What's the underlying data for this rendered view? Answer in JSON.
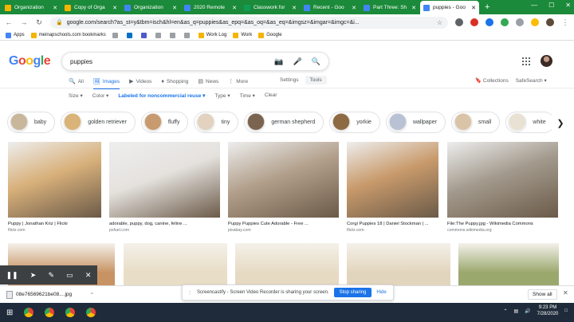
{
  "browser": {
    "tabs": [
      {
        "label": "Organization",
        "color": "#f4b400"
      },
      {
        "label": "Copy of Orga",
        "color": "#f4b400"
      },
      {
        "label": "Organization",
        "color": "#4285f4"
      },
      {
        "label": "2020 Remote",
        "color": "#4285f4"
      },
      {
        "label": "Classwork for",
        "color": "#0f9d58"
      },
      {
        "label": "Recent - Goo",
        "color": "#4285f4"
      },
      {
        "label": "Part Three: Sh",
        "color": "#4285f4"
      },
      {
        "label": "puppies - Goo",
        "color": "#4285f4",
        "active": true
      }
    ],
    "url": "google.com/search?as_st=y&tbm=isch&hl=en&as_q=puppies&as_epq=&as_oq=&as_eq=&imgsz=&imgar=&imgc=&i...",
    "bookmarks": [
      {
        "label": "Apps",
        "icon": "apps-icon"
      },
      {
        "label": "meinapschools.com bookmarks",
        "icon": "folder-icon"
      },
      {
        "label": "",
        "icon": "square-icon"
      },
      {
        "label": "",
        "icon": "outlook-icon"
      },
      {
        "label": "",
        "icon": "teams-icon"
      },
      {
        "label": "",
        "icon": "square-icon"
      },
      {
        "label": "",
        "icon": "square-icon"
      },
      {
        "label": "",
        "icon": "square-icon"
      },
      {
        "label": "Work Log",
        "icon": "folder-icon"
      },
      {
        "label": "Work",
        "icon": "folder-icon"
      },
      {
        "label": "Google",
        "icon": "folder-icon"
      }
    ]
  },
  "google": {
    "logo": "Google",
    "query": "puppies",
    "tabs": [
      {
        "label": "All",
        "icon": "search-icon"
      },
      {
        "label": "Images",
        "icon": "image-icon",
        "active": true
      },
      {
        "label": "Videos",
        "icon": "video-icon"
      },
      {
        "label": "Shopping",
        "icon": "tag-icon"
      },
      {
        "label": "News",
        "icon": "news-icon"
      },
      {
        "label": "More",
        "icon": "more-icon"
      }
    ],
    "settings": "Settings",
    "tools": "Tools",
    "collections": "Collections",
    "safesearch": "SafeSearch ▾",
    "filters": [
      {
        "label": "Size ▾"
      },
      {
        "label": "Color ▾"
      },
      {
        "label": "Labeled for noncommercial reuse ▾",
        "selected": true
      },
      {
        "label": "Type ▾"
      },
      {
        "label": "Time ▾"
      },
      {
        "label": "Clear"
      }
    ],
    "chips": [
      {
        "label": "baby",
        "color": "#c9b79c"
      },
      {
        "label": "golden retriever",
        "color": "#d9b377"
      },
      {
        "label": "fluffy",
        "color": "#c79b6f"
      },
      {
        "label": "tiny",
        "color": "#e2d2bf"
      },
      {
        "label": "german shepherd",
        "color": "#7a6450"
      },
      {
        "label": "yorkie",
        "color": "#8d6a44"
      },
      {
        "label": "wallpaper",
        "color": "#b9c1d4"
      },
      {
        "label": "small",
        "color": "#dac4a8"
      },
      {
        "label": "white",
        "color": "#e9e1d3"
      }
    ],
    "results": [
      {
        "caption": "Puppy | Jonathan Kriz | Flickr",
        "source": "flickr.com",
        "color": "#d8b07a"
      },
      {
        "caption": "adorable, puppy, dog, canine, feline ...",
        "source": "pxfuel.com",
        "color": "#e5e2de"
      },
      {
        "caption": "Puppy Puppies Cute Adorable - Free ...",
        "source": "pixabay.com",
        "color": "#b2a08c"
      },
      {
        "caption": "Corgi Puppies 18 | Daniel Stockman | ...",
        "source": "flickr.com",
        "color": "#c89a6b"
      },
      {
        "caption": "File:The Puppy.jpg - Wikimedia Commons",
        "source": "commons.wikimedia.org",
        "color": "#a39a8d"
      }
    ],
    "row2_colors": [
      "#c79363",
      "#e8ddc6",
      "#e6dac2",
      "#e2d5bd",
      "#9aa86d"
    ]
  },
  "downloads": {
    "file": "08e76569621be08....jpg",
    "show_all": "Show all",
    "banner_text": "Screencastify - Screen Video Recorder is sharing your screen.",
    "stop": "Stop sharing",
    "hide": "Hide"
  },
  "taskbar": {
    "time": "9:23 PM",
    "date": "7/28/2020"
  }
}
